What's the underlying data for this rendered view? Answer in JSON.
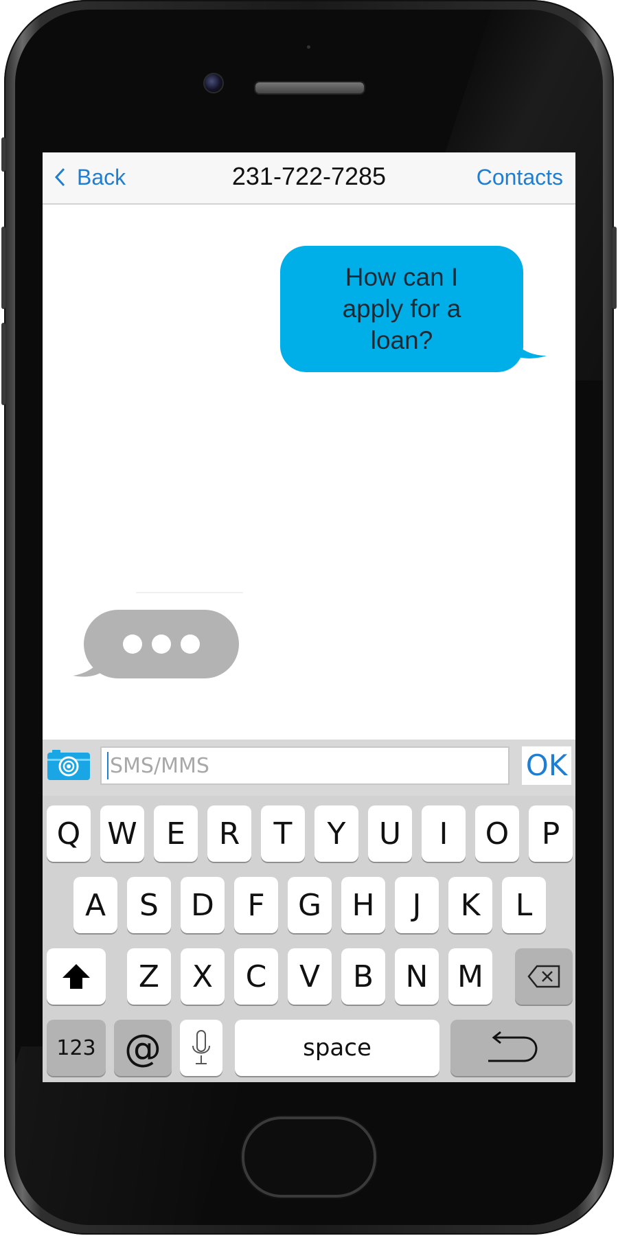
{
  "nav": {
    "back_label": "Back",
    "back_icon": "chevron-left-icon",
    "title": "231-722-7285",
    "contacts_label": "Contacts"
  },
  "messages": {
    "sent_text": "How can I apply for a loan?",
    "typing_indicator": "typing-dots"
  },
  "compose": {
    "camera_icon": "camera-icon",
    "placeholder": "SMS/MMS",
    "value": "",
    "ok_label": "OK"
  },
  "keyboard": {
    "row1": [
      "Q",
      "W",
      "E",
      "R",
      "T",
      "Y",
      "U",
      "I",
      "O",
      "P"
    ],
    "row2": [
      "A",
      "S",
      "D",
      "F",
      "G",
      "H",
      "J",
      "K",
      "L"
    ],
    "row3": [
      "Z",
      "X",
      "C",
      "V",
      "B",
      "N",
      "M"
    ],
    "shift_icon": "shift-arrow-icon",
    "backspace_icon": "backspace-icon",
    "numbers_label": "123",
    "at_label": "@",
    "mic_icon": "microphone-icon",
    "space_label": "space",
    "return_icon": "return-arrow-icon"
  },
  "colors": {
    "sent_bubble": "#00aee8",
    "typing_bubble": "#b3b3b3",
    "accent": "#1f7ed1"
  }
}
